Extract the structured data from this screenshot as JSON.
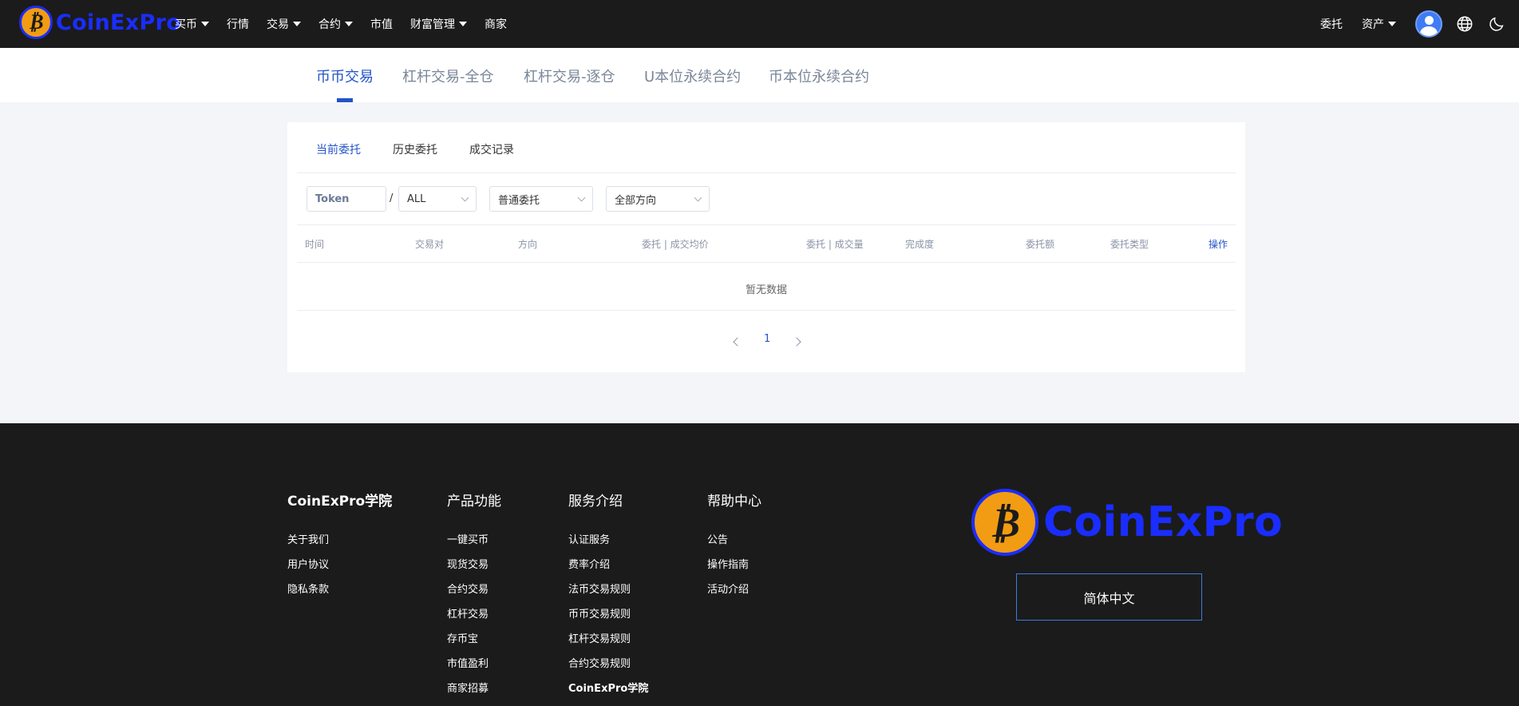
{
  "nav": {
    "brand": "CoinExPro",
    "items": [
      {
        "label": "买币",
        "dropdown": true
      },
      {
        "label": "行情",
        "dropdown": false
      },
      {
        "label": "交易",
        "dropdown": true
      },
      {
        "label": "合约",
        "dropdown": true
      },
      {
        "label": "市值",
        "dropdown": false
      },
      {
        "label": "财富管理",
        "dropdown": true
      },
      {
        "label": "商家",
        "dropdown": false
      }
    ],
    "right": {
      "orders": "委托",
      "assets": "资产"
    }
  },
  "subtabs": [
    {
      "label": "币币交易",
      "active": true
    },
    {
      "label": "杠杆交易-全仓",
      "active": false
    },
    {
      "label": "杠杆交易-逐仓",
      "active": false
    },
    {
      "label": "U本位永续合约",
      "active": false
    },
    {
      "label": "币本位永续合约",
      "active": false
    }
  ],
  "order_tabs": [
    {
      "label": "当前委托",
      "active": true
    },
    {
      "label": "历史委托",
      "active": false
    },
    {
      "label": "成交记录",
      "active": false
    }
  ],
  "filters": {
    "token_placeholder": "Token",
    "separator": "/",
    "quote": "ALL",
    "order_type": "普通委托",
    "direction": "全部方向"
  },
  "table": {
    "columns": [
      "时间",
      "交易对",
      "方向",
      "委托 | 成交均价",
      "委托 | 成交量",
      "完成度",
      "委托额",
      "委托类型",
      "操作"
    ],
    "empty_text": "暂无数据"
  },
  "pagination": {
    "current": "1"
  },
  "footer": {
    "columns": [
      {
        "title": "CoinExPro学院",
        "links": [
          "关于我们",
          "用户协议",
          "隐私条款"
        ]
      },
      {
        "title": "产品功能",
        "links": [
          "一键买币",
          "现货交易",
          "合约交易",
          "杠杆交易",
          "存币宝",
          "市值盈利",
          "商家招募"
        ]
      },
      {
        "title": "服务介绍",
        "links": [
          "认证服务",
          "费率介绍",
          "法币交易规则",
          "币币交易规则",
          "杠杆交易规则",
          "合约交易规则",
          "CoinExPro学院"
        ]
      },
      {
        "title": "帮助中心",
        "links": [
          "公告",
          "操作指南",
          "活动介绍"
        ]
      }
    ],
    "brand": "CoinExPro",
    "language": "简体中文"
  },
  "colors": {
    "accent": "#2453c9",
    "brand_blue": "#1a2dff",
    "coin_orange": "#f29c13",
    "dark": "#1b1b1b"
  }
}
